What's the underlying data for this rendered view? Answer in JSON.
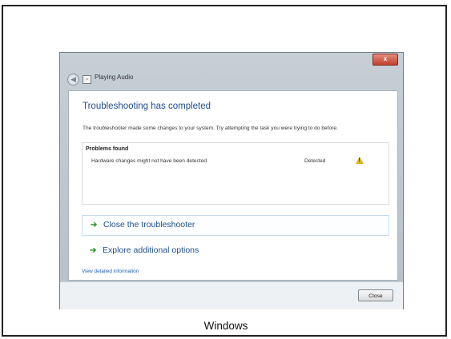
{
  "window": {
    "title": "Playing Audio",
    "close_glyph": "x",
    "back_glyph": "◀",
    "app_icon_glyph": "▫"
  },
  "main": {
    "heading": "Troubleshooting has completed",
    "description": "The troubleshooter made some changes to your system. Try attempting the task you were trying to do before.",
    "problems_header": "Problems found",
    "problems": [
      {
        "name": "Hardware changes might not have been detected",
        "status": "Detected",
        "icon": "warning-icon"
      }
    ],
    "options": [
      {
        "label": "Close the troubleshooter",
        "icon": "green-arrow-icon"
      },
      {
        "label": "Explore additional options",
        "icon": "green-arrow-icon"
      }
    ],
    "detail_link": "View detailed information"
  },
  "footer": {
    "close_label": "Close"
  },
  "caption": "Windows",
  "colors": {
    "heading": "#1e4f91",
    "link": "#1e5fb4",
    "arrow": "#2c9a2c",
    "warning": "#e0b21c",
    "close_x": "#c2402d"
  }
}
